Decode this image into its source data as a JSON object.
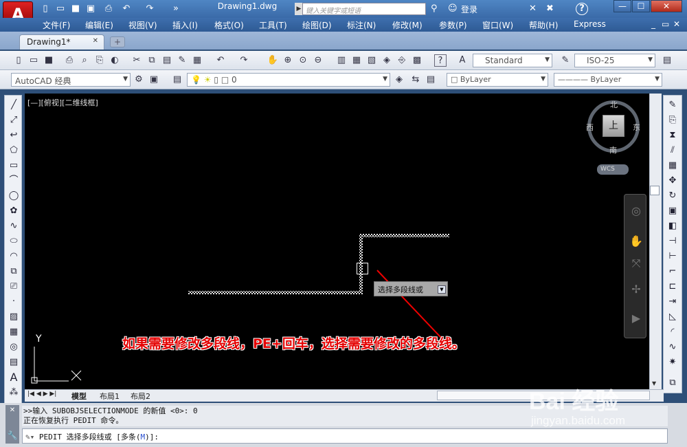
{
  "titlebar": {
    "app_button": "A",
    "document_title": "Drawing1.dwg",
    "search_placeholder": "键入关键字或短语",
    "login": "登录",
    "help": "?",
    "window_controls": [
      "—",
      "☐",
      "✕"
    ]
  },
  "menubar": {
    "items": [
      "文件(F)",
      "编辑(E)",
      "视图(V)",
      "插入(I)",
      "格式(O)",
      "工具(T)",
      "绘图(D)",
      "标注(N)",
      "修改(M)",
      "参数(P)",
      "窗口(W)",
      "帮助(H)",
      "Express"
    ],
    "window_controls": [
      "_",
      "▭",
      "✕"
    ]
  },
  "doc_tabs": {
    "active_tab": "Drawing1*",
    "close": "✕"
  },
  "toolbar": {
    "text_style": "Standard",
    "dim_style": "ISO-25",
    "workspace": "AutoCAD 经典",
    "layer": "0",
    "color": "ByLayer",
    "linetype": "ByLayer"
  },
  "viewport": {
    "control_label": "[—][俯视][二维线框]",
    "viewcube": {
      "top": "上",
      "north": "北",
      "south": "南",
      "east": "东",
      "west": "西"
    },
    "wcs": "WCS",
    "ucs_y": "Y"
  },
  "layout_tabs": [
    "模型",
    "布局1",
    "布局2"
  ],
  "tooltip": {
    "text": "选择多段线或"
  },
  "annotation": {
    "text": "如果需要修改多段线，PE+回车，选择需要修改的多段线。",
    "color": "#e40000"
  },
  "command": {
    "history": [
      ">>输入 SUBOBJSELECTIONMODE 的新值 <0>: 0",
      "正在恢复执行 PEDIT 命令。"
    ],
    "prompt_prefix": "PEDIT 选择多段线或 [多条(",
    "prompt_key": "M",
    "prompt_suffix": ")]:"
  },
  "watermark": {
    "brand": "Bai 经验",
    "url": "jingyan.baidu.com"
  },
  "colors": {
    "canvas_bg": "#000000",
    "title_blue": "#3a6aa8",
    "polyline_dash": "#e6e6e6"
  }
}
